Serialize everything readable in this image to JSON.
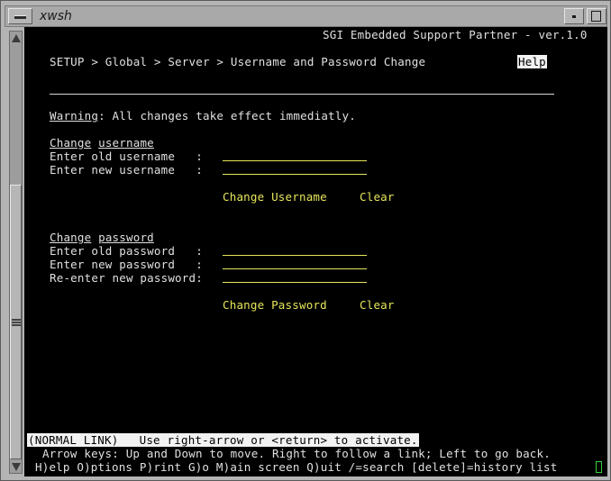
{
  "window": {
    "title": "xwsh"
  },
  "terminal": {
    "header": "SGI Embedded Support Partner - ver.1.0",
    "breadcrumb": "SETUP > Global > Server > Username and Password Change",
    "help_label": "Help",
    "warning_label": "Warning",
    "warning_text": ": All changes take effect immediatly.",
    "username_section": {
      "title_word1": "Change",
      "title_word2": "username",
      "old_label": "Enter old username   :",
      "new_label": "Enter new username   :",
      "submit": "Change Username",
      "clear": "Clear"
    },
    "password_section": {
      "title_word1": "Change",
      "title_word2": "password",
      "old_label": "Enter old password   :",
      "new_label": "Enter new password   :",
      "reenter_label": "Re-enter new password:",
      "submit": "Change Password",
      "clear": "Clear"
    },
    "status_line": "(NORMAL LINK)   Use right-arrow or <return> to activate.",
    "help_line1": "Arrow keys: Up and Down to move. Right to follow a link; Left to go back.",
    "help_line2": "H)elp O)ptions P)rint G)o M)ain screen Q)uit /=search [delete]=history list"
  },
  "colors": {
    "background": "#000000",
    "text": "#e0e0e0",
    "link": "#e6e65a",
    "cursor": "#38d038"
  }
}
